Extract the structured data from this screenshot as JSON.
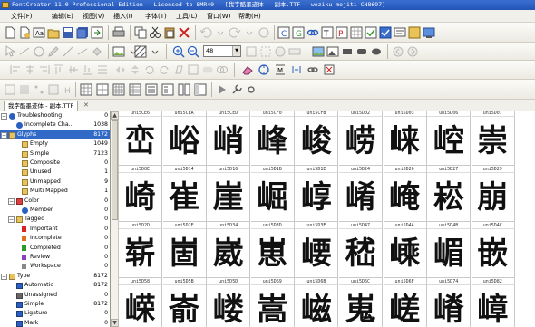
{
  "title": "FontCreator 11.0 Professional Edition - Licensed to SMR40 - [我字酷墨迹体 - 副本.TTF - woziku-mojiti-CN8697]",
  "menu": [
    {
      "label": "文件(F)"
    },
    {
      "label": "编辑(E)"
    },
    {
      "label": "视图(V)"
    },
    {
      "label": "插入(I)"
    },
    {
      "label": "字体(T)"
    },
    {
      "label": "工具(L)"
    },
    {
      "label": "窗口(W)"
    },
    {
      "label": "帮助(H)"
    }
  ],
  "zoom_value": "48",
  "doc_tab": "我字酷墨迹体 - 副本.TTF",
  "tree": [
    {
      "label": "Troubleshooting",
      "count": "0",
      "icon": "info-icon",
      "color": "#2a5fc0"
    },
    {
      "label": "Incomplete Cha...",
      "count": "1038",
      "icon": "info-icon",
      "color": "#2a5fc0"
    },
    {
      "label": "Glyphs",
      "count": "8172",
      "icon": "folder-icon",
      "color": "#e9c35a"
    },
    {
      "label": "Empty",
      "count": "1049",
      "icon": "folder-icon",
      "color": "#e9c35a"
    },
    {
      "label": "Simple",
      "count": "7123",
      "icon": "folder-icon",
      "color": "#e9c35a"
    },
    {
      "label": "Composite",
      "count": "0",
      "icon": "folder-icon",
      "color": "#e9c35a"
    },
    {
      "label": "Unused",
      "count": "1",
      "icon": "folder-icon",
      "color": "#e9c35a"
    },
    {
      "label": "Unmapped",
      "count": "9",
      "icon": "folder-icon",
      "color": "#e9c35a"
    },
    {
      "label": "Multi Mapped",
      "count": "1",
      "icon": "folder-icon",
      "color": "#e9c35a"
    },
    {
      "label": "Color",
      "count": "0",
      "icon": "color-icon",
      "color": "#d94040"
    },
    {
      "label": "Member",
      "count": "0",
      "icon": "member-icon",
      "color": "#2a5fc0"
    },
    {
      "label": "Tagged",
      "count": "0",
      "icon": "folder-icon",
      "color": "#e9c35a"
    },
    {
      "label": "Important",
      "count": "0",
      "icon": "flag-icon",
      "color": "#d22"
    },
    {
      "label": "Incomplete",
      "count": "0",
      "icon": "flag-icon",
      "color": "#e07020"
    },
    {
      "label": "Completed",
      "count": "0",
      "icon": "flag-icon",
      "color": "#2a9a2a"
    },
    {
      "label": "Review",
      "count": "0",
      "icon": "flag-icon",
      "color": "#8a40c0"
    },
    {
      "label": "Workspace",
      "count": "0",
      "icon": "flag-icon",
      "color": "#888"
    },
    {
      "label": "Type",
      "count": "8172",
      "icon": "folder-icon",
      "color": "#e9c35a"
    },
    {
      "label": "Automatic",
      "count": "8172",
      "icon": "automatic-icon",
      "color": "#2a5fc0"
    },
    {
      "label": "Unassigned",
      "count": "0",
      "icon": "question-icon",
      "color": "#666"
    },
    {
      "label": "Simple",
      "count": "8172",
      "icon": "simple-icon",
      "color": "#2a5fc0"
    },
    {
      "label": "Ligature",
      "count": "0",
      "icon": "ligature-icon",
      "color": "#2a5fc0"
    },
    {
      "label": "Mark",
      "count": "0",
      "icon": "mark-icon",
      "color": "#2a5fc0"
    }
  ],
  "glyph_grid": {
    "rows": [
      {
        "labels": [
          "uni5CE6",
          "uni5CEA",
          "uni5CED",
          "uni5CF0",
          "uni5CFB",
          "uni5D02",
          "uni5D03",
          "uni5D06",
          "uni5D07"
        ],
        "glyphs": [
          "峦",
          "峪",
          "峭",
          "峰",
          "峻",
          "崂",
          "崃",
          "崆",
          "崇"
        ]
      },
      {
        "labels": [
          "uni5D0E",
          "uni5D14",
          "uni5D16",
          "uni5D1B",
          "uni5D1E",
          "uni5D24",
          "uni5D26",
          "uni5D27",
          "uni5D29"
        ],
        "glyphs": [
          "崎",
          "崔",
          "崖",
          "崛",
          "崞",
          "崤",
          "崦",
          "崧",
          "崩"
        ]
      },
      {
        "labels": [
          "uni5D2D",
          "uni5D2E",
          "uni5D34",
          "uni5D3D",
          "uni5D3E",
          "uni5D47",
          "uni5D4A",
          "uni5D4B",
          "uni5D4C"
        ],
        "glyphs": [
          "崭",
          "崮",
          "崴",
          "崽",
          "崾",
          "嵇",
          "嵊",
          "嵋",
          "嵌"
        ]
      },
      {
        "labels": [
          "uni5D58",
          "uni5D5B",
          "uni5D5D",
          "uni5D69",
          "uni5D6B",
          "uni5D6C",
          "uni5D6F",
          "uni5D74",
          "uni5D82"
        ],
        "glyphs": [
          "嵘",
          "嵛",
          "嵝",
          "嵩",
          "嵫",
          "嵬",
          "嵯",
          "嵴",
          "嶂"
        ]
      }
    ]
  }
}
